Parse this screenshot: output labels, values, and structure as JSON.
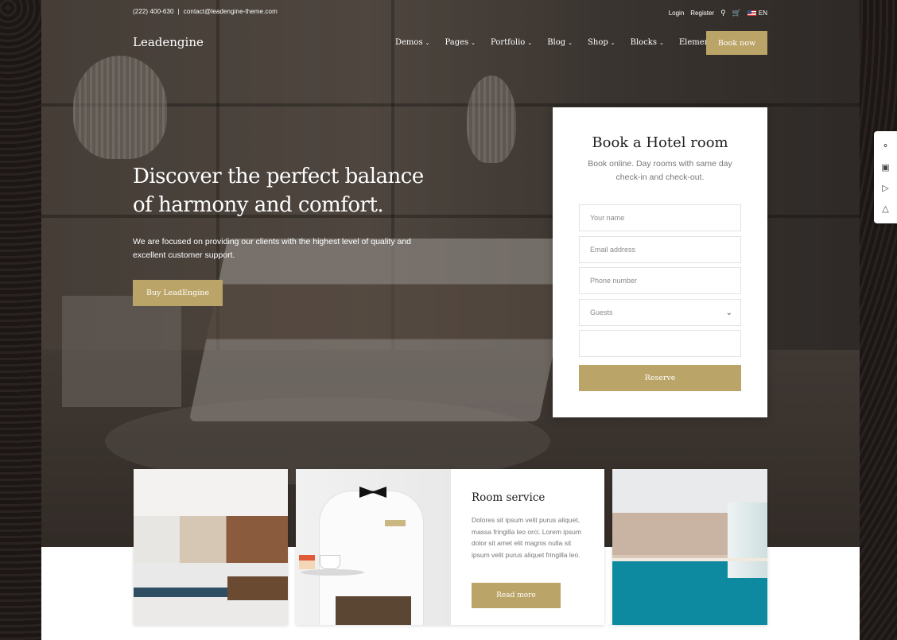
{
  "topbar": {
    "phone": "(222) 400-630",
    "separator": "|",
    "email": "contact@leadengine-theme.com"
  },
  "toplinks": {
    "login": "Login",
    "register": "Register",
    "search_icon": "search-icon",
    "cart_icon": "cart-icon",
    "language": "EN"
  },
  "header": {
    "logo": "Leadengine",
    "nav": [
      {
        "label": "Demos"
      },
      {
        "label": "Pages"
      },
      {
        "label": "Portfolio"
      },
      {
        "label": "Blog"
      },
      {
        "label": "Shop"
      },
      {
        "label": "Blocks"
      },
      {
        "label": "Elements"
      }
    ],
    "cta": "Book now"
  },
  "hero": {
    "headline": "Discover the perfect balance of harmony and comfort.",
    "lead": "We are focused on providing our clients with the highest level of quality and excellent customer support.",
    "button": "Buy LeadEngine"
  },
  "booking": {
    "title": "Book a Hotel room",
    "subtitle": "Book online. Day rooms with same day check-in and check-out.",
    "fields": {
      "name_placeholder": "Your name",
      "email_placeholder": "Email address",
      "phone_placeholder": "Phone number",
      "guests_value": "Guests",
      "extra_value": ""
    },
    "submit": "Reserve"
  },
  "room_service": {
    "title": "Room service",
    "text": "Dolores sit ipsum velit purus aliquet, massa fringilla leo orci. Lorem ipsum dolor sit amet elit magnis nulla sit ipsum velit purus aliquet fringilla leo.",
    "button": "Read more"
  },
  "sidebar_icons": [
    "chat-icon",
    "book-icon",
    "play-icon",
    "flask-icon"
  ],
  "colors": {
    "accent": "#bba467"
  }
}
